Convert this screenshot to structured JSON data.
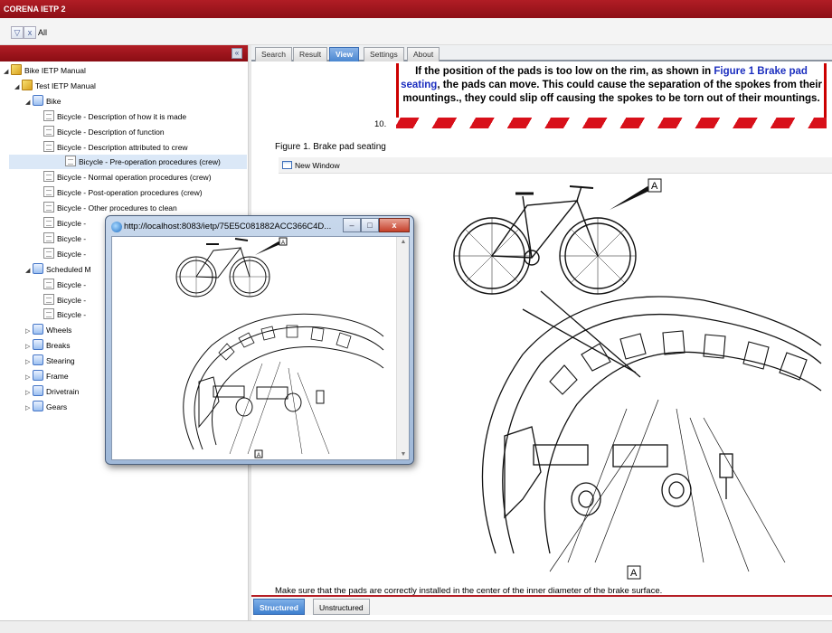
{
  "app": {
    "title": "CORENA IETP 2"
  },
  "filterbar": {
    "all_label": "All"
  },
  "tree": [
    {
      "label": "Bike IETP Manual",
      "level": 0,
      "icon": "book",
      "toggle": "▲"
    },
    {
      "label": "Test IETP Manual",
      "level": 1,
      "icon": "book",
      "toggle": "▲"
    },
    {
      "label": "Bike",
      "level": 2,
      "icon": "blue",
      "toggle": "▲"
    },
    {
      "label": "Bicycle - Description of how it is made",
      "level": 3,
      "icon": "doc"
    },
    {
      "label": "Bicycle - Description of function",
      "level": 3,
      "icon": "doc"
    },
    {
      "label": "Bicycle - Description attributed to crew",
      "level": 3,
      "icon": "doc"
    },
    {
      "label": "Bicycle - Pre-operation procedures (crew)",
      "level": 3,
      "icon": "doc",
      "selected": true
    },
    {
      "label": "Bicycle - Normal operation procedures (crew)",
      "level": 3,
      "icon": "doc"
    },
    {
      "label": "Bicycle - Post-operation procedures (crew)",
      "level": 3,
      "icon": "doc"
    },
    {
      "label": "Bicycle - Other procedures to clean",
      "level": 3,
      "icon": "doc"
    },
    {
      "label": "Bicycle -",
      "level": 3,
      "icon": "doc"
    },
    {
      "label": "Bicycle -",
      "level": 3,
      "icon": "doc"
    },
    {
      "label": "Bicycle -",
      "level": 3,
      "icon": "doc"
    },
    {
      "label": "Scheduled M",
      "level": 2,
      "icon": "blue",
      "toggle": "▲"
    },
    {
      "label": "Bicycle -",
      "level": 3,
      "icon": "doc"
    },
    {
      "label": "Bicycle -",
      "level": 3,
      "icon": "doc"
    },
    {
      "label": "Bicycle -",
      "level": 3,
      "icon": "doc"
    },
    {
      "label": "Wheels",
      "level": 2,
      "icon": "blue",
      "toggle": "▷"
    },
    {
      "label": "Breaks",
      "level": 2,
      "icon": "blue",
      "toggle": "▷"
    },
    {
      "label": "Stearing",
      "level": 2,
      "icon": "blue",
      "toggle": "▷"
    },
    {
      "label": "Frame",
      "level": 2,
      "icon": "blue",
      "toggle": "▷"
    },
    {
      "label": "Drivetrain",
      "level": 2,
      "icon": "blue",
      "toggle": "▷"
    },
    {
      "label": "Gears",
      "level": 2,
      "icon": "blue",
      "toggle": "▷"
    }
  ],
  "tabs": [
    "Search",
    "Result",
    "View",
    "Settings",
    "About"
  ],
  "active_tab": "View",
  "warning": {
    "text_before": "If the position of the pads is too low on the rim, as shown in ",
    "link_text": "Figure 1 Brake pad seating",
    "text_after": ", the pads can move. This could cause the separation of the spokes from their mountings., they could slip off causing the spokes to be torn out of their mountings.",
    "step_number": "10."
  },
  "figure": {
    "title": "Figure 1. Brake pad seating",
    "new_window_label": "New Window",
    "callout": "A"
  },
  "bottom_note": "Make sure that the pads are correctly installed in the center of the inner diameter of the brake surface.",
  "bottom_tabs": [
    "Structured",
    "Unstructured"
  ],
  "popup": {
    "url": "http://localhost:8083/ietp/75E5C081882ACC366C4D...",
    "callout": "A"
  },
  "colors": {
    "brand_red": "#a0141c",
    "active_tab_blue": "#4a86d0",
    "link_blue": "#1c2fbf"
  }
}
